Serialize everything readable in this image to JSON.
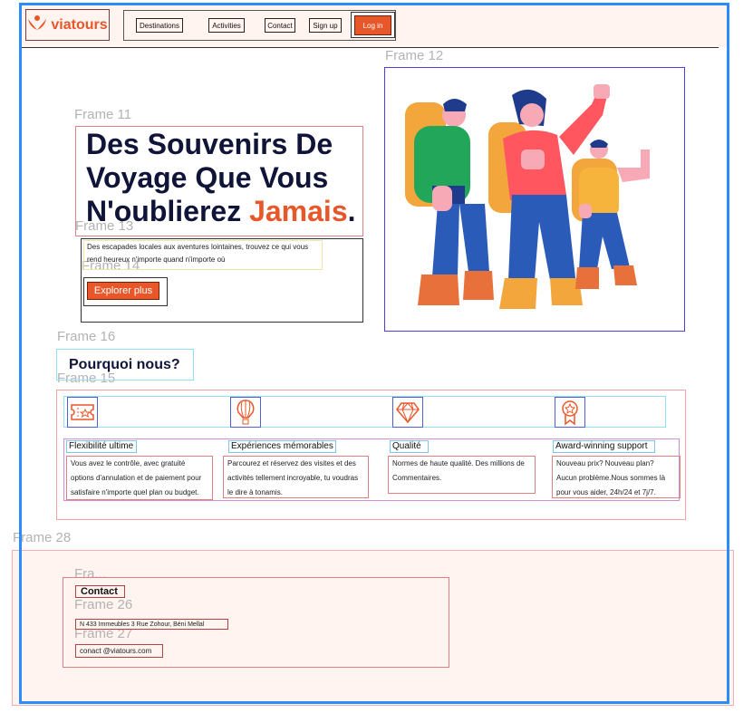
{
  "colors": {
    "accent": "#e8572a",
    "heading": "#0f1438",
    "selection": "#2b8cff"
  },
  "frame_labels": {
    "f11": "Frame 11",
    "f12": "Frame 12",
    "f13": "Frame 13",
    "f14": "Frame 14",
    "f15": "Frame 15",
    "f16": "Frame 16",
    "f28": "Frame 28",
    "fra": "Fra...",
    "f26": "Frame 26",
    "f27": "Frame 27"
  },
  "header": {
    "logo_text": "viatours",
    "logo_icon": "heart-hands-icon",
    "nav": [
      "Destinations",
      "Activities",
      "Contact",
      "Sign up"
    ],
    "login_label": "Log in"
  },
  "hero": {
    "title_line1": "Des Souvenirs De",
    "title_line2": "Voyage Que Vous",
    "title_line3_start": "N'oublierez ",
    "title_accent": "Jamais",
    "title_end": ".",
    "description": "Des escapades locales aux aventures lointaines, trouvez ce qui vous rend heureux n'importe quand n'importe où",
    "cta_label": "Explorer plus",
    "illustration": "hikers-illustration"
  },
  "why": {
    "heading": "Pourquoi nous?",
    "features": [
      {
        "icon": "ticket-icon",
        "title": "Flexibilité ultime",
        "text": "Vous avez le contrôle, avec gratuité options d'annulation et de paiement pour satisfaire n'importe quel plan ou budget."
      },
      {
        "icon": "hot-air-balloon-icon",
        "title": "Expériences mémorables",
        "text": "Parcourez et réservez des visites et des activités tellement incroyable, tu voudras le dire à tonamis."
      },
      {
        "icon": "diamond-icon",
        "title": "Qualité",
        "text": "Normes de haute qualité. Des millions de Commentaires."
      },
      {
        "icon": "award-icon",
        "title": "Award-winning support",
        "text": "Nouveau prix? Nouveau plan? Aucun problème.Nous sommes là pour vous aider, 24h/24 et 7j/7."
      }
    ]
  },
  "footer": {
    "heading": "Contact",
    "address": "N 433 Immeubles 3 Rue Zohour, Béni Mellal",
    "email": "conact @viatours.com"
  }
}
